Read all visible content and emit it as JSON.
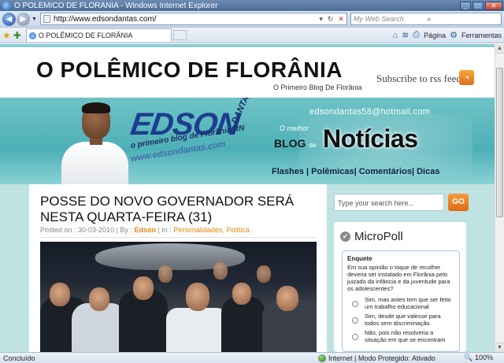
{
  "window": {
    "title": "O POLÊMICO DE FLORÂNIA - Windows Internet Explorer"
  },
  "address_bar": {
    "url": "http://www.edsondantas.com/",
    "search_placeholder": "My Web Search"
  },
  "tabs": {
    "active_tab": "O POLÊMICO DE FLORÂNIA",
    "page_menu": "Página",
    "tools_menu": "Ferramentas"
  },
  "blog": {
    "title": "O POLÊMICO DE FLORÂNIA",
    "tagline": "O Primeiro Blog De Florânia",
    "rss_label": "Subscribe to rss feed :"
  },
  "banner": {
    "brand": "EDSON",
    "brand_vertical": "DANTAS.COM",
    "brand_sub": "o primeiro blog de Florânia/RN",
    "site": "www.edsondantas.com",
    "email": "edsondantas58@hotmail.com",
    "o_melhor": "O melhor",
    "blog": "BLOG",
    "de": "de",
    "noticias": "Notícias",
    "links": "Flashes | Polêmicas| Comentários| Dicas"
  },
  "post": {
    "title": "POSSE DO NOVO GOVERNADOR SERÁ NESTA QUARTA-FEIRA (31)",
    "posted_prefix": "Posted on : 30-03-2010 | By :",
    "author": "Edson",
    "in_label": "| In :",
    "categories": "Personalidades, Política"
  },
  "sidebar": {
    "search_placeholder": "Type your search here...",
    "go_label": "GO",
    "poll_title": "MicroPoll",
    "enquete_label": "Enquete",
    "question": "Em sua opinião o toque de recolher deveria ser instalado em Florânia pelo juizado da infância e da juventude para os adolescentes?",
    "options": [
      "Sim, mas antes tem que ser feito um trabalho educacional",
      "Sim, desde que valesse para todos sem discriminação",
      "Não, pois não resolveria a situação em que se encontram"
    ]
  },
  "status": {
    "left": "Concluído",
    "zone": "Internet | Modo Protegido: Ativado",
    "zoom": "100%"
  }
}
